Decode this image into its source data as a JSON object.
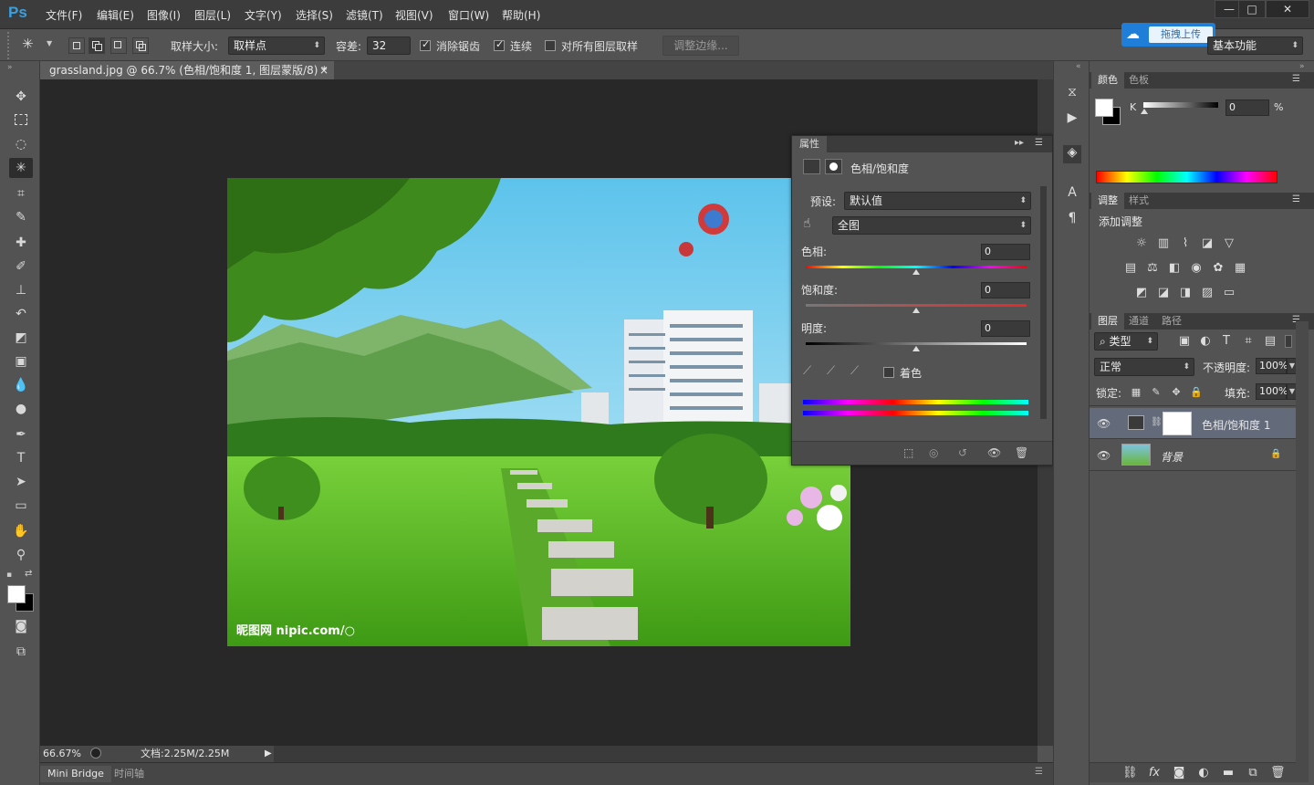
{
  "app": {
    "logo": "Ps"
  },
  "menu": [
    "文件(F)",
    "编辑(E)",
    "图像(I)",
    "图层(L)",
    "文字(Y)",
    "选择(S)",
    "滤镜(T)",
    "视图(V)",
    "窗口(W)",
    "帮助(H)"
  ],
  "window_controls": {
    "minimize": "—",
    "restore": "□",
    "close": "✕"
  },
  "upload_badge": {
    "text": "拖拽上传"
  },
  "workspace": {
    "value": "基本功能"
  },
  "options": {
    "sample_size_label": "取样大小:",
    "sample_size_value": "取样点",
    "tolerance_label": "容差:",
    "tolerance_value": "32",
    "antialias_label": "消除锯齿",
    "antialias_checked": true,
    "contiguous_label": "连续",
    "contiguous_checked": true,
    "all_layers_label": "对所有图层取样",
    "all_layers_checked": false,
    "refine_edge_label": "调整边缘..."
  },
  "document": {
    "tab_title": "grassland.jpg @ 66.7% (色相/饱和度 1, 图层蒙版/8) *",
    "close": "×",
    "watermark": "昵图网 nipic.com/○"
  },
  "status": {
    "zoom": "66.67%",
    "doc_info": "文档:2.25M/2.25M"
  },
  "bottom_tabs": [
    "Mini Bridge",
    "时间轴"
  ],
  "properties": {
    "tab": "属性",
    "title": "色相/饱和度",
    "preset_label": "预设:",
    "preset_value": "默认值",
    "channel_value": "全图",
    "hue_label": "色相:",
    "hue_value": "0",
    "saturation_label": "饱和度:",
    "saturation_value": "0",
    "lightness_label": "明度:",
    "lightness_value": "0",
    "colorize_label": "着色",
    "colorize_checked": false
  },
  "color_panel": {
    "tabs": [
      "颜色",
      "色板"
    ],
    "channel_label": "K",
    "channel_value": "0",
    "unit": "%"
  },
  "adjustments_panel": {
    "tabs": [
      "调整",
      "样式"
    ],
    "heading": "添加调整"
  },
  "layers_panel": {
    "tabs": [
      "图层",
      "通道",
      "路径"
    ],
    "filter_value": "类型",
    "blend_mode": "正常",
    "opacity_label": "不透明度:",
    "opacity_value": "100%",
    "lock_label": "锁定:",
    "fill_label": "填充:",
    "fill_value": "100%",
    "layers": [
      {
        "name": "色相/饱和度 1",
        "selected": true
      },
      {
        "name": "背景",
        "selected": false
      }
    ]
  },
  "colors": {
    "accent": "#39a0e0",
    "panel": "#535353",
    "canvas": "#282828"
  }
}
